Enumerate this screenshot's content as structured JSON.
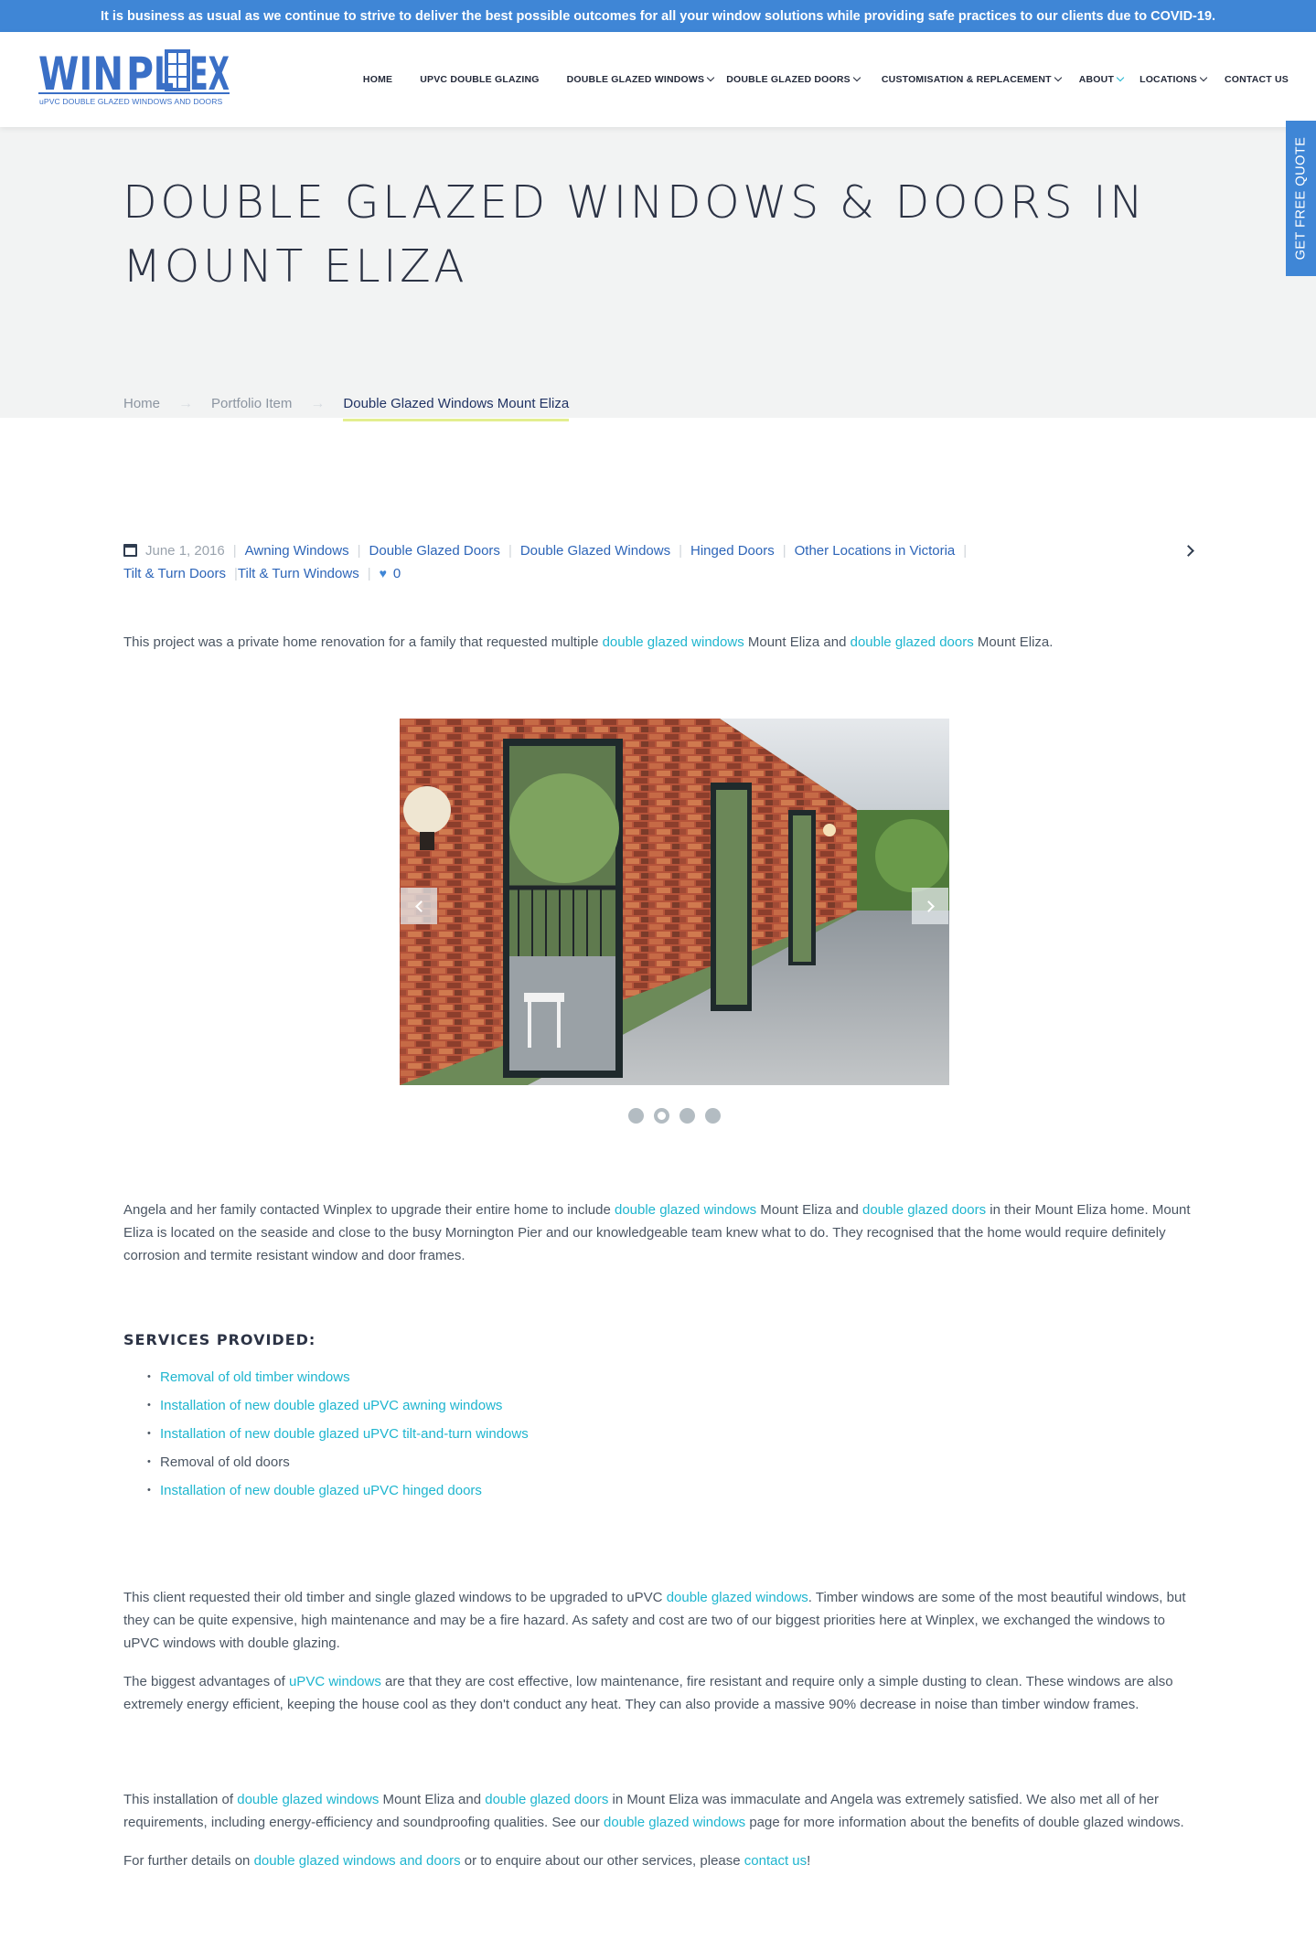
{
  "banner": "It is business as usual as we continue to strive to deliver the best possible outcomes for all your window solutions while providing safe practices to our clients due to COVID-19.",
  "logo": {
    "word": "WINPLEX",
    "tagline": "uPVC DOUBLE GLAZED WINDOWS AND DOORS",
    "color": "#3a6fc6"
  },
  "nav": {
    "home": "HOME",
    "upvc": "UPVC DOUBLE GLAZING",
    "windows": "DOUBLE GLAZED WINDOWS",
    "doors": "DOUBLE GLAZED DOORS",
    "custom": "CUSTOMISATION & REPLACEMENT",
    "about": "ABOUT",
    "locations": "LOCATIONS",
    "contact": "CONTACT US"
  },
  "quote_tab": "GET FREE QUOTE",
  "hero": {
    "title": "DOUBLE GLAZED WINDOWS & DOORS IN MOUNT ELIZA",
    "breadcrumb": [
      "Home",
      "Portfolio Item",
      "Double Glazed Windows Mount Eliza"
    ]
  },
  "meta": {
    "date": "June 1, 2016",
    "categories": [
      "Awning Windows",
      "Double Glazed Doors",
      "Double Glazed Windows",
      "Hinged Doors",
      "Other Locations in Victoria",
      "Tilt & Turn Doors",
      "Tilt & Turn Windows"
    ],
    "likes": "0"
  },
  "intro": {
    "t1": "This project was a private home renovation for a family that requested multiple ",
    "l1": "double glazed windows",
    "t2": " Mount Eliza and ",
    "l2": "double glazed doors",
    "t3": " Mount Eliza."
  },
  "gallery": {
    "slides": 4,
    "active": 1
  },
  "para1": {
    "t1": "Angela and her family contacted Winplex to upgrade their entire home to include ",
    "l1": "double glazed windows",
    "t2": " Mount Eliza and ",
    "l2": "double glazed doors",
    "t3": " in their Mount Eliza home. Mount Eliza is located on the seaside and close to the busy Mornington Pier and our knowledgeable team knew what to do. They recognised that the home would require definitely corrosion and termite resistant window and door frames."
  },
  "services": {
    "title": "SERVICES PROVIDED:",
    "items": [
      "Removal of old timber windows",
      "Installation of new double glazed uPVC awning windows",
      "Installation of new double glazed uPVC tilt-and-turn windows",
      "Removal of old doors",
      "Installation of new double glazed uPVC hinged doors"
    ]
  },
  "para2": {
    "t1": "This client requested their old timber and single glazed windows to be upgraded to uPVC ",
    "l1": "double glazed windows",
    "t2": ". Timber windows are some of the most beautiful windows, but they can be quite expensive, high maintenance and may be a fire hazard. As safety and cost are two of our biggest priorities here at Winplex, we exchanged the windows to uPVC windows with double glazing."
  },
  "para3": {
    "t1": "The biggest advantages of ",
    "l1": "uPVC windows",
    "t2": " are that they are cost effective, low maintenance, fire resistant and require only a simple dusting to clean. These windows are also extremely energy efficient, keeping the house cool as they don't conduct any heat. They can also provide a massive 90% decrease in noise than timber window frames."
  },
  "para4": {
    "t1": "This installation of ",
    "l1": "double glazed windows",
    "t2": " Mount Eliza and ",
    "l2": "double glazed doors",
    "t3": " in Mount Eliza was immaculate and Angela was extremely satisfied. We also met all of her requirements, including energy-efficiency and soundproofing qualities. See our ",
    "l3": "double glazed windows",
    "t4": " page for more information about the benefits of double glazed windows."
  },
  "para5": {
    "t1": "For further details on ",
    "l1": "double glazed windows and doors",
    "t2": " or to enquire about our other services, please ",
    "l2": "contact us",
    "t3": "!"
  },
  "colors": {
    "banner": "#3f86d6",
    "link": "#1eb5cf",
    "meta_link": "#2d65b8",
    "heading": "#2c3345",
    "hero_bg": "#f2f3f3"
  }
}
